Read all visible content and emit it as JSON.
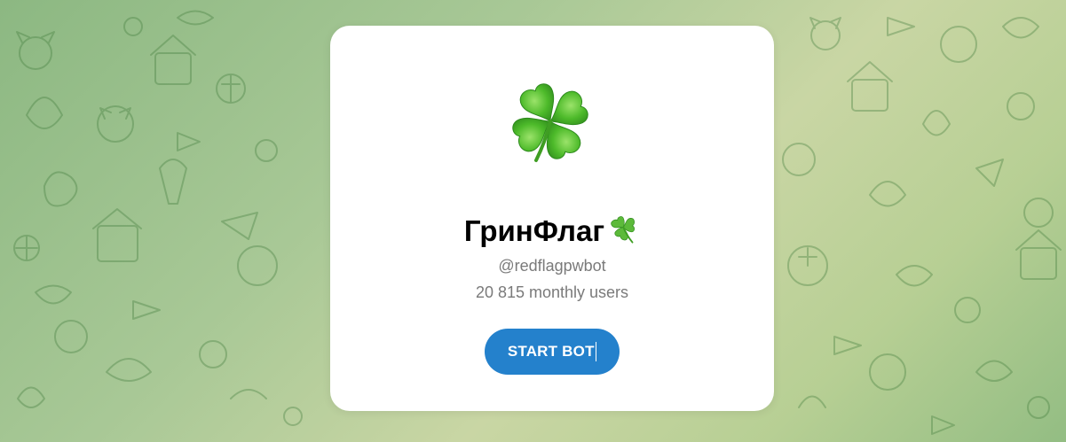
{
  "bot": {
    "name": "ГринФлаг",
    "handle": "@redflagpwbot",
    "monthly_users": "20 815 monthly users",
    "avatar_icon": "four-leaf-clover-icon",
    "title_emoji_icon": "shamrock-icon"
  },
  "actions": {
    "start_label": "START BOT"
  },
  "colors": {
    "button": "#2481cc",
    "card": "#ffffff",
    "background": "#a8c896"
  }
}
